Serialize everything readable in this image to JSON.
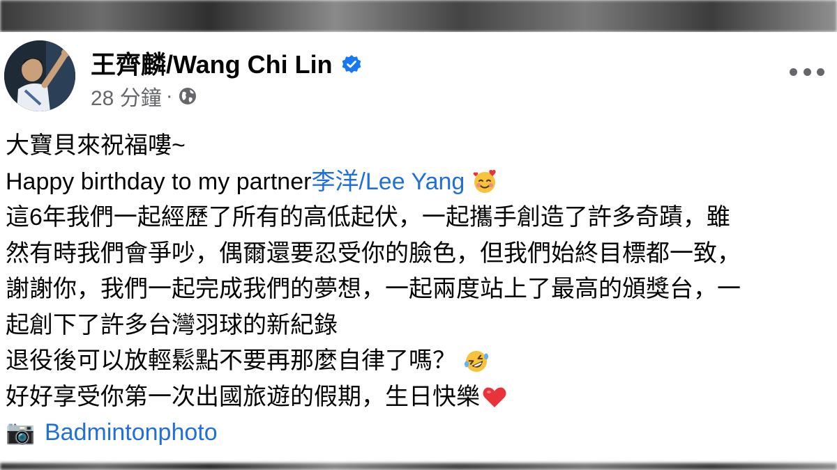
{
  "post": {
    "author": "王齊麟/Wang Chi Lin",
    "timestamp": "28 分鐘",
    "separator": "·",
    "lines": {
      "l1": "大寶貝來祝福嘍~",
      "l2_prefix": "Happy birthday to my partner",
      "l2_tag": "李洋/Lee Yang",
      "l3": "這6年我們一起經歷了所有的高低起伏，一起攜手創造了許多奇蹟，雖",
      "l4": "然有時我們會爭吵，偶爾還要忍受你的臉色，但我們始終目標都一致，",
      "l5": "謝謝你，我們一起完成我們的夢想，一起兩度站上了最高的頒獎台，一",
      "l6": "起創下了許多台灣羽球的新紀錄",
      "l7": "退役後可以放輕鬆點不要再那麼自律了嗎？",
      "l8": "好好享受你第一次出國旅遊的假期，生日快樂",
      "l9_icon": "📷",
      "l9_link": "Badmintonphoto"
    }
  },
  "colors": {
    "link": "#216fdb",
    "verified": "#1877f2",
    "meta": "#65676b"
  },
  "icons": [
    "verified-badge-icon",
    "globe-icon",
    "more-options-icon",
    "smiling-face-with-hearts-icon",
    "rolling-on-floor-laughing-icon",
    "red-heart-icon",
    "camera-icon"
  ]
}
